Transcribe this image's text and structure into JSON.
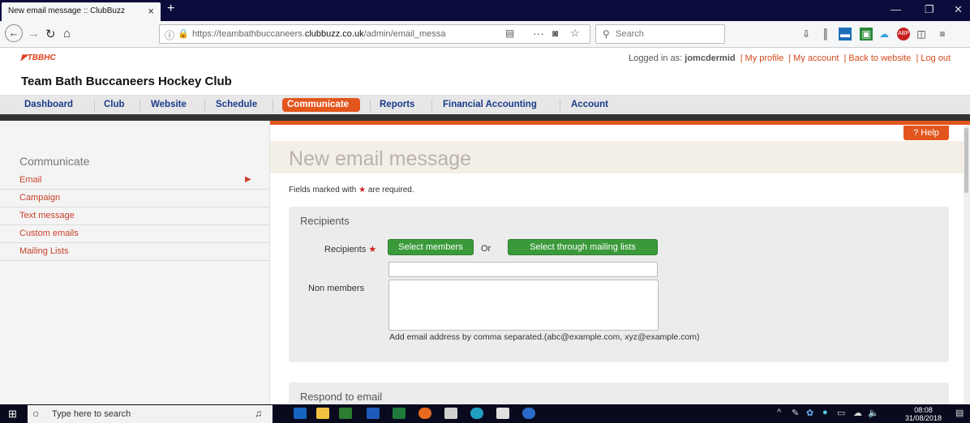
{
  "browser": {
    "tab_title": "New email message :: ClubBuzz",
    "tab_close": "×",
    "new_tab": "+",
    "url_prefix": "https://teambathbuccaneers.",
    "url_domain": "clubbuzz.co.uk",
    "url_path": "/admin/email_messa",
    "search_placeholder": "Search",
    "icons": [
      "back-icon",
      "forward-icon",
      "reload-icon",
      "home-icon",
      "info-icon",
      "lock-icon",
      "reader-icon",
      "more-icon",
      "pocket-icon",
      "bookmark-star-icon",
      "search-icon",
      "downloads-icon",
      "library-icon",
      "sidebar-icon",
      "menu-icon"
    ]
  },
  "site": {
    "logo_text": "TBBHC",
    "logged_in_label": "Logged in as:",
    "username": "jomcdermid",
    "links": [
      "My profile",
      "My account",
      "Back to website",
      "Log out"
    ],
    "club_name": "Team Bath Buccaneers Hockey Club"
  },
  "nav": {
    "items": [
      "Dashboard",
      "Club",
      "Website",
      "Schedule",
      "Communicate",
      "Reports",
      "Financial Accounting",
      "Account"
    ],
    "active": "Communicate"
  },
  "sidebar": {
    "title": "Communicate",
    "items": [
      "Email",
      "Campaign",
      "Text message",
      "Custom emails",
      "Mailing Lists"
    ],
    "active_marker": "▶"
  },
  "main": {
    "help_label": "? Help",
    "page_title": "New email message",
    "required_note_pre": "Fields marked with",
    "required_star": "★",
    "required_note_post": "are required.",
    "recipients_panel": {
      "heading": "Recipients",
      "recipients_label": "Recipients",
      "select_members": "Select members",
      "or": "Or",
      "select_lists": "Select through mailing lists",
      "non_members_label": "Non members",
      "non_members_input_value": "",
      "non_members_textarea_value": "",
      "hint": "Add email address by comma separated.(abc@example.com, xyz@example.com)"
    },
    "respond_panel": {
      "heading": "Respond to email"
    }
  },
  "taskbar": {
    "search_placeholder": "Type here to search",
    "clock_time": "08:08",
    "clock_date": "31/08/2018"
  },
  "colors": {
    "accent_orange": "#e2561e",
    "nav_blue": "#1b3a8a",
    "link_red": "#c8412a",
    "button_green": "#3a9a3a"
  }
}
